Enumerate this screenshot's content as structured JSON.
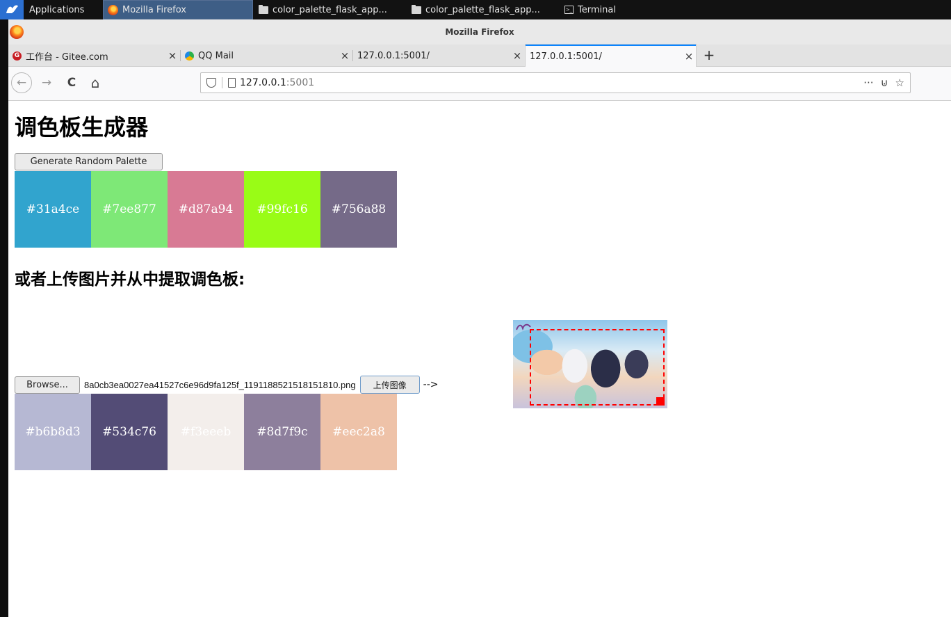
{
  "taskbar": {
    "apps_label": "Applications",
    "tasks": [
      {
        "label": "Mozilla Firefox"
      },
      {
        "label": "color_palette_flask_app..."
      },
      {
        "label": "color_palette_flask_app..."
      },
      {
        "label": "Terminal"
      }
    ]
  },
  "window": {
    "title": "Mozilla Firefox"
  },
  "tabs": [
    {
      "label": "工作台 - Gitee.com",
      "favicon": "G"
    },
    {
      "label": "QQ Mail"
    },
    {
      "label": "127.0.0.1:5001/"
    },
    {
      "label": "127.0.0.1:5001/"
    }
  ],
  "tab_close_glyph": "×",
  "new_tab_glyph": "+",
  "nav": {
    "back_glyph": "←",
    "forward_glyph": "→",
    "reload_glyph": "C",
    "home_glyph": "⌂",
    "url_host": "127.0.0.1",
    "url_port": ":5001",
    "more_glyph": "···",
    "pocket_glyph": "⊍",
    "star_glyph": "☆"
  },
  "page": {
    "title": "调色板生成器",
    "generate_button": "Generate Random Palette",
    "random_palette": [
      {
        "hex": "#31a4ce",
        "label": "#31a4ce"
      },
      {
        "hex": "#7ee877",
        "label": "#7ee877"
      },
      {
        "hex": "#d87a94",
        "label": "#d87a94"
      },
      {
        "hex": "#99fc16",
        "label": "#99fc16"
      },
      {
        "hex": "#756a88",
        "label": "#756a88"
      }
    ],
    "upload_heading": "或者上传图片并从中提取调色板:",
    "browse_button": "Browse...",
    "file_name": "8a0cb3ea0027ea41527c6e96d9fa125f_1191188521518151810.png",
    "upload_button": "上传图像",
    "arrow_text": "-->",
    "extracted_palette": [
      {
        "hex": "#b6b8d3",
        "label": "#b6b8d3"
      },
      {
        "hex": "#534c76",
        "label": "#534c76"
      },
      {
        "hex": "#f3eeeb",
        "label": "#f3eeeb"
      },
      {
        "hex": "#8d7f9c",
        "label": "#8d7f9c"
      },
      {
        "hex": "#eec2a8",
        "label": "#eec2a8"
      }
    ]
  }
}
